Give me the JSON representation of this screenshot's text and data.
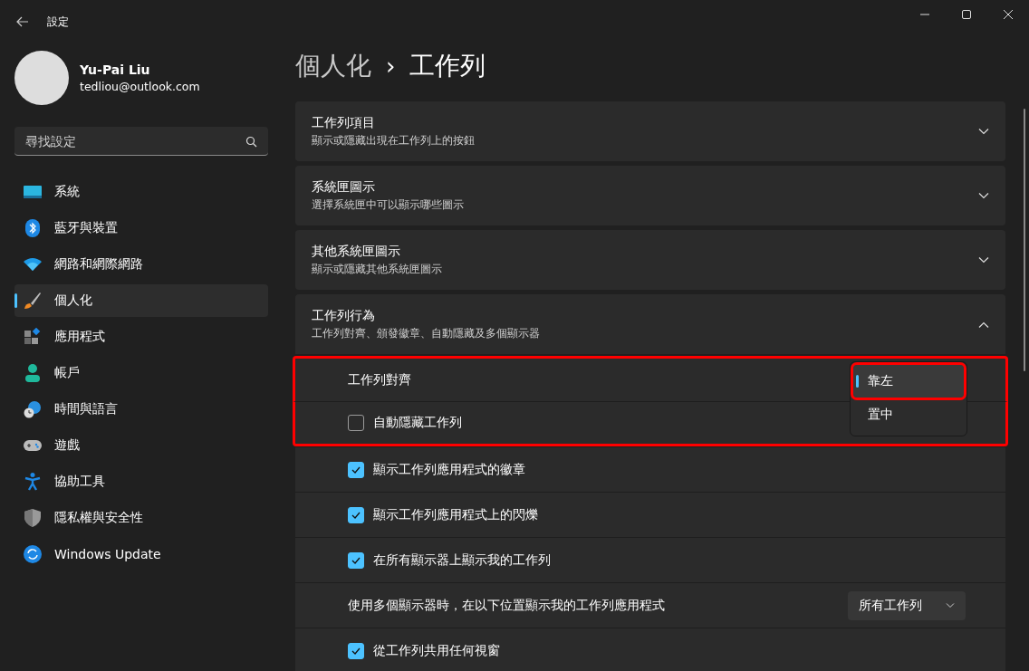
{
  "window": {
    "title": "設定"
  },
  "user": {
    "name": "Yu-Pai Liu",
    "email": "tedliou@outlook.com"
  },
  "search": {
    "placeholder": "尋找設定"
  },
  "nav": [
    {
      "label": "系統",
      "kind": "system",
      "selected": false
    },
    {
      "label": "藍牙與裝置",
      "kind": "bluetooth",
      "selected": false
    },
    {
      "label": "網路和網際網路",
      "kind": "wifi",
      "selected": false
    },
    {
      "label": "個人化",
      "kind": "brush",
      "selected": true
    },
    {
      "label": "應用程式",
      "kind": "apps",
      "selected": false
    },
    {
      "label": "帳戶",
      "kind": "account",
      "selected": false
    },
    {
      "label": "時間與語言",
      "kind": "time",
      "selected": false
    },
    {
      "label": "遊戲",
      "kind": "gaming",
      "selected": false
    },
    {
      "label": "協助工具",
      "kind": "accessibility",
      "selected": false
    },
    {
      "label": "隱私權與安全性",
      "kind": "privacy",
      "selected": false
    },
    {
      "label": "Windows Update",
      "kind": "update",
      "selected": false
    }
  ],
  "breadcrumb": {
    "parent": "個人化",
    "separator": "›",
    "current": "工作列"
  },
  "sections": [
    {
      "title": "工作列項目",
      "subtitle": "顯示或隱藏出現在工作列上的按鈕",
      "expanded": false
    },
    {
      "title": "系統匣圖示",
      "subtitle": "選擇系統匣中可以顯示哪些圖示",
      "expanded": false
    },
    {
      "title": "其他系統匣圖示",
      "subtitle": "顯示或隱藏其他系統匣圖示",
      "expanded": false
    },
    {
      "title": "工作列行為",
      "subtitle": "工作列對齊、頒發徽章、自動隱藏及多個顯示器",
      "expanded": true
    }
  ],
  "behavior_rows": [
    {
      "kind": "open_select",
      "label": "工作列對齊",
      "highlighted": true,
      "options": [
        {
          "label": "靠左",
          "selected": true,
          "highlighted": true
        },
        {
          "label": "置中",
          "selected": false,
          "highlighted": false
        }
      ]
    },
    {
      "kind": "checkbox",
      "label": "自動隱藏工作列",
      "checked": false,
      "highlighted": true
    },
    {
      "kind": "checkbox",
      "label": "顯示工作列應用程式的徽章",
      "checked": true,
      "highlighted": false
    },
    {
      "kind": "checkbox",
      "label": "顯示工作列應用程式上的閃爍",
      "checked": true,
      "highlighted": false
    },
    {
      "kind": "checkbox",
      "label": "在所有顯示器上顯示我的工作列",
      "checked": true,
      "highlighted": false
    },
    {
      "kind": "dropdown",
      "label": "使用多個顯示器時，在以下位置顯示我的工作列應用程式",
      "value": "所有工作列",
      "highlighted": false
    },
    {
      "kind": "checkbox",
      "label": "從工作列共用任何視窗",
      "checked": true,
      "highlighted": false
    }
  ]
}
